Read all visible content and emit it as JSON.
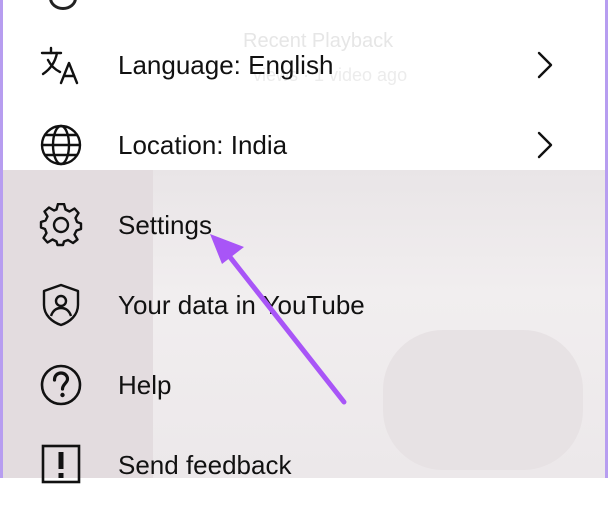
{
  "background": {
    "ghost_line1": "Recent Playback",
    "ghost_line2": "views · 1 video ago"
  },
  "menu": {
    "items": [
      {
        "label": "Language: English",
        "icon": "translate-icon",
        "has_chevron": true
      },
      {
        "label": "Location: India",
        "icon": "globe-icon",
        "has_chevron": true
      },
      {
        "label": "Settings",
        "icon": "gear-icon",
        "has_chevron": false
      },
      {
        "label": "Your data in YouTube",
        "icon": "shield-person-icon",
        "has_chevron": false
      },
      {
        "label": "Help",
        "icon": "help-circle-icon",
        "has_chevron": false
      },
      {
        "label": "Send feedback",
        "icon": "feedback-icon",
        "has_chevron": false
      }
    ]
  },
  "annotation": {
    "arrow_color": "#a855f7",
    "border_color": "#b79df0",
    "points_to": "Settings"
  }
}
